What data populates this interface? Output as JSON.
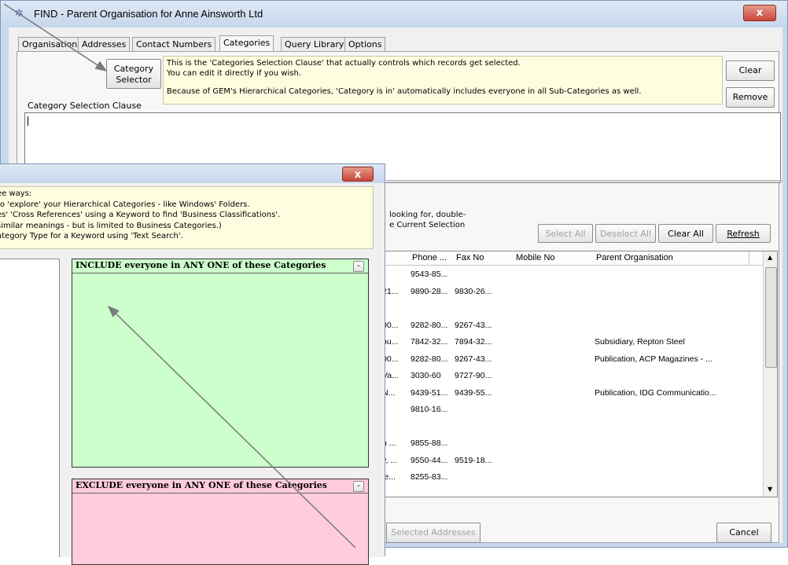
{
  "main_window": {
    "title": "FIND - Parent Organisation for Anne Ainsworth Ltd",
    "close_glyph": "x",
    "tabs": [
      "Organisations",
      "Addresses",
      "Contact Numbers",
      "Categories",
      "Query Library",
      "Options"
    ],
    "active_tab": "Categories",
    "category_selector_line1": "Category",
    "category_selector_line2": "Selector",
    "info_line1": "This is the 'Categories Selection Clause' that actually controls which records get selected.",
    "info_line2": "You can edit it directly if you wish.",
    "info_line3": "Because of GEM's Hierarchical Categories, 'Category is in' automatically includes everyone in all Sub-Categories as well.",
    "clause_label": "Category Selection Clause",
    "clause_value": "",
    "clear_label": "Clear",
    "remove_label": "Remove",
    "hint_line1": "looking for, double-",
    "hint_line2": "e Current Selection",
    "select_all": "Select All",
    "deselect_all": "Deselect All",
    "clear_all": "Clear All",
    "refresh": "Refresh",
    "columns": [
      "Phone ...",
      "Fax No",
      "Mobile No",
      "Parent Organisation"
    ],
    "rows": [
      {
        "a": "",
        "phone": "9543-85...",
        "fax": "",
        "mobile": "",
        "parent": ""
      },
      {
        "a": "21...",
        "phone": "9890-28...",
        "fax": "9830-26...",
        "mobile": "",
        "parent": ""
      },
      {
        "a": "",
        "phone": "",
        "fax": "",
        "mobile": "",
        "parent": ""
      },
      {
        "a": "00...",
        "phone": "9282-80...",
        "fax": "9267-43...",
        "mobile": "",
        "parent": ""
      },
      {
        "a": "ou...",
        "phone": "7842-32...",
        "fax": "7894-32...",
        "mobile": "",
        "parent": "Subsidiary, Repton Steel"
      },
      {
        "a": "00...",
        "phone": "9282-80...",
        "fax": "9267-43...",
        "mobile": "",
        "parent": "Publication, ACP Magazines - ..."
      },
      {
        "a": "Va...",
        "phone": "3030-60",
        "fax": "9727-90...",
        "mobile": "",
        "parent": ""
      },
      {
        "a": "N...",
        "phone": "9439-51...",
        "fax": "9439-55...",
        "mobile": "",
        "parent": "Publication, IDG Communicatio..."
      },
      {
        "a": "",
        "phone": "9810-16...",
        "fax": "",
        "mobile": "",
        "parent": ""
      },
      {
        "a": "",
        "phone": "",
        "fax": "",
        "mobile": "",
        "parent": ""
      },
      {
        "a": "n ...",
        "phone": "9855-88...",
        "fax": "",
        "mobile": "",
        "parent": ""
      },
      {
        "a": "y, ...",
        "phone": "9550-44...",
        "fax": "9519-18...",
        "mobile": "",
        "parent": ""
      },
      {
        "a": "le...",
        "phone": "8255-83...",
        "fax": "",
        "mobile": "",
        "parent": ""
      }
    ],
    "selected_addresses": "Selected Addresses",
    "cancel": "Cancel"
  },
  "popup": {
    "close_glyph": "x",
    "info_lines": [
      "ee ways:",
      " to 'explore' your Hierarchical Categories - like Windows' Folders.",
      "es' 'Cross References' using a Keyword to find 'Business Classifications'.",
      "similar meanings - but is limited to Business Categories.)",
      "ategory Type for a Keyword using 'Text Search'."
    ],
    "include_title": "INCLUDE everyone in ANY ONE of these Categories",
    "exclude_title": "EXCLUDE everyone in ANY ONE of these Categories",
    "dropdown_glyph": "-"
  },
  "colors": {
    "info_bg": "#fdfde0",
    "include_bg": "#ccffcc",
    "exclude_bg": "#ffccdd"
  }
}
